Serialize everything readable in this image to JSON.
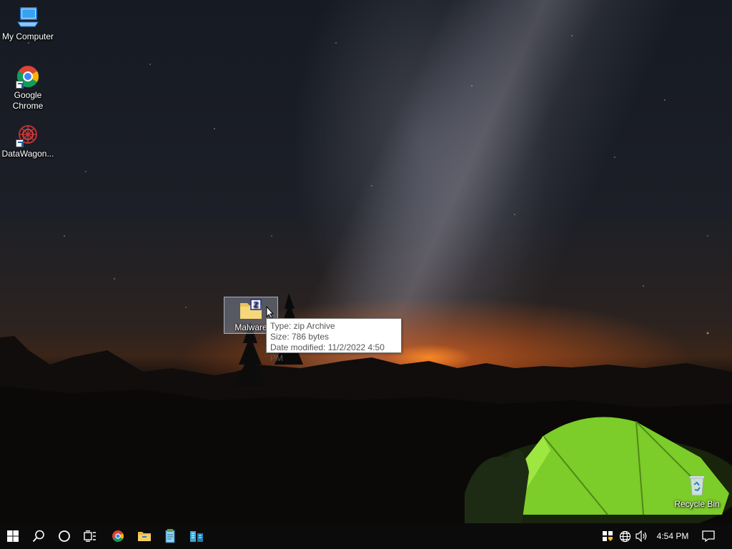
{
  "desktop": {
    "icons": [
      {
        "label": "My Computer",
        "icon": "computer-icon"
      },
      {
        "label": "Google Chrome",
        "icon": "chrome-icon"
      },
      {
        "label": "DataWagon...",
        "icon": "datawagon-icon"
      },
      {
        "label": "Recycle Bin",
        "icon": "recycle-bin-icon"
      }
    ],
    "selected_file": {
      "label": "Malware",
      "icon": "zip-folder-icon"
    },
    "tooltip": {
      "type_line": "Type: zip Archive",
      "size_line": "Size: 786 bytes",
      "date_line": "Date modified: 11/2/2022 4:50 PM"
    }
  },
  "taskbar": {
    "pinned": [
      "start-icon",
      "search-icon",
      "cortana-icon",
      "task-view-icon",
      "chrome-icon",
      "file-explorer-icon",
      "notepad-icon",
      "datawagon-icon"
    ],
    "tray": [
      "security-shield-icon",
      "network-globe-icon",
      "volume-icon"
    ],
    "clock": "4:54 PM",
    "notification": "action-center-icon"
  },
  "colors": {
    "taskbar_bg": "#0b0b0c",
    "tooltip_border": "#767676",
    "selection": "#aabedc",
    "tent_green": "#8ad82c"
  }
}
